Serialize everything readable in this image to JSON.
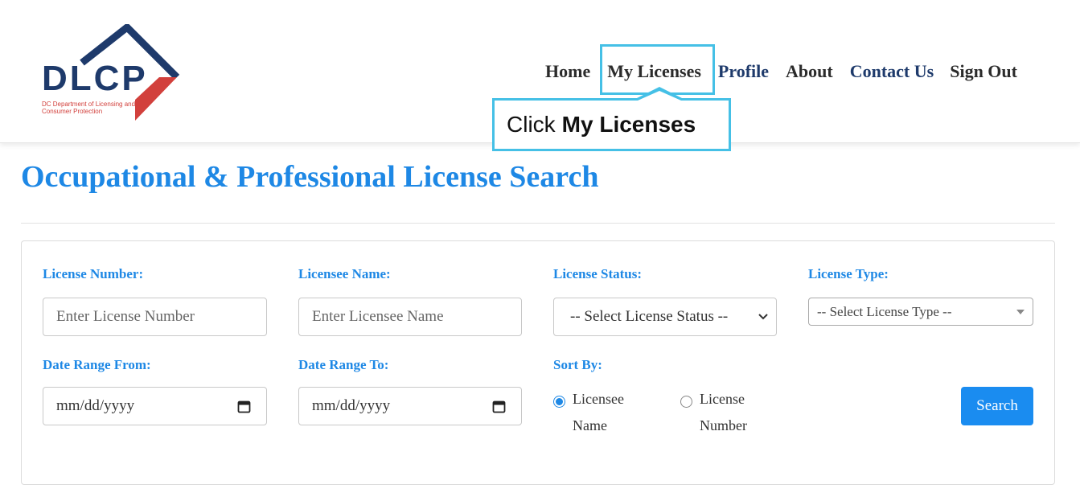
{
  "logo": {
    "text": "DLCP",
    "subtitle": "DC Department of Licensing and Consumer Protection",
    "colors": {
      "navy": "#1e3a6b",
      "red": "#d2403c"
    }
  },
  "nav": {
    "items": [
      {
        "label": "Home",
        "active": false
      },
      {
        "label": "My Licenses",
        "active": true
      },
      {
        "label": "Profile",
        "active": false
      },
      {
        "label": "About",
        "active": false
      },
      {
        "label": "Contact Us",
        "active": false
      },
      {
        "label": "Sign Out",
        "active": false
      }
    ]
  },
  "tooltip": {
    "prefix": "Click",
    "target": "My Licenses",
    "accent": "#45c0e6"
  },
  "page": {
    "title": "Occupational & Professional License Search",
    "title_color": "#1e88e5"
  },
  "form": {
    "license_number": {
      "label": "License Number:",
      "placeholder": "Enter License Number"
    },
    "licensee_name": {
      "label": "Licensee Name:",
      "placeholder": "Enter Licensee Name"
    },
    "license_status": {
      "label": "License Status:",
      "value": "-- Select License Status --"
    },
    "license_type": {
      "label": "License Type:",
      "value": "-- Select License Type --"
    },
    "date_from": {
      "label": "Date Range From:",
      "value": "mm/dd/yyyy"
    },
    "date_to": {
      "label": "Date Range To:",
      "value": "mm/dd/yyyy"
    },
    "sort_by": {
      "label": "Sort By:",
      "options": [
        {
          "label": "Licensee Name",
          "checked": true
        },
        {
          "label": "License Number",
          "checked": false
        }
      ]
    },
    "search_label": "Search",
    "button_color": "#1a8cf0"
  }
}
